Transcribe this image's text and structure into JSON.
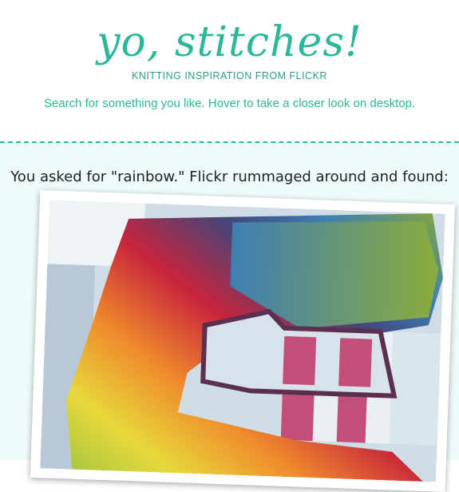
{
  "header": {
    "logo": "yo, stitches!",
    "tagline": "KNITTING INSPIRATION FROM FLICKR",
    "instructions": "Search for something you like. Hover to take a closer look on desktop."
  },
  "results": {
    "heading": "You asked for \"rainbow.\" Flickr rummaged around and found:"
  },
  "colors": {
    "accent": "#2bb89a",
    "results_background": "#eefbfa"
  }
}
